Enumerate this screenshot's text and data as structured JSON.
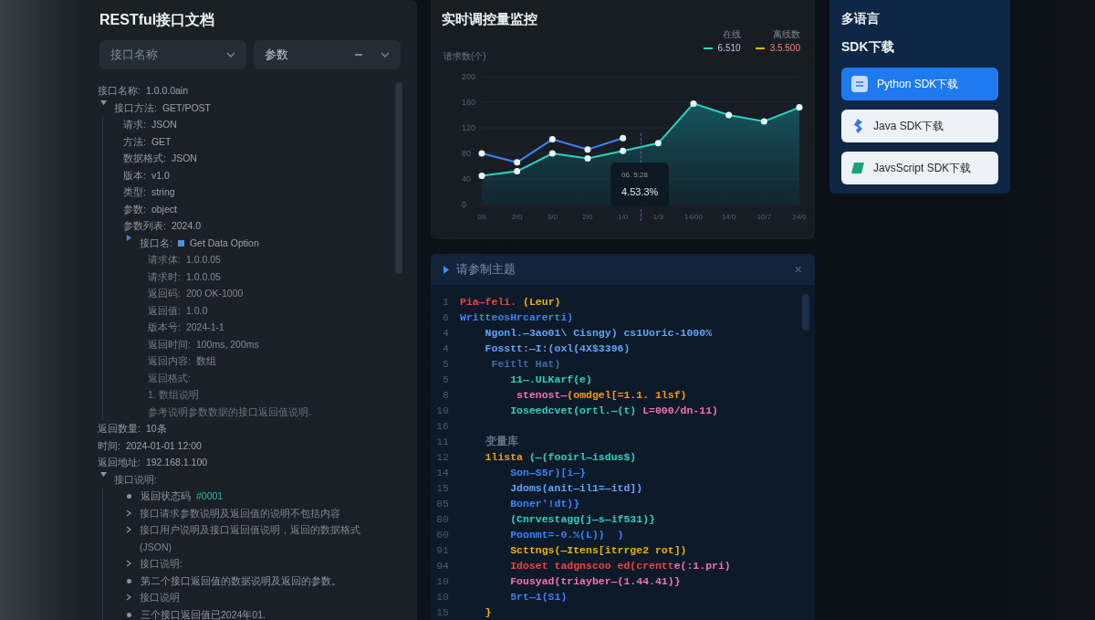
{
  "docs": {
    "title": "RESTful接口文档",
    "selects": [
      {
        "placeholder": "接口名称",
        "minus": false
      },
      {
        "value": "参数",
        "minus": true
      }
    ],
    "tree": [
      {
        "kind": "field",
        "label": "接口名称:",
        "value": "1.0.0.0ain"
      },
      {
        "kind": "field",
        "label": "接口方法:",
        "value": "GET/POST",
        "expanded": true,
        "children": [
          {
            "kind": "field",
            "label": "请求:",
            "value": "JSON"
          },
          {
            "kind": "field",
            "label": "方法:",
            "value": "GET"
          },
          {
            "kind": "field",
            "label": "数据格式:",
            "value": "JSON"
          },
          {
            "kind": "field",
            "label": "版本:",
            "value": "v1.0"
          },
          {
            "kind": "field",
            "label": "类型:",
            "value": "string"
          },
          {
            "kind": "field",
            "label": "参数:",
            "value": "object"
          },
          {
            "kind": "field",
            "label": "参数列表:",
            "value": "2024.0"
          },
          {
            "kind": "field",
            "label": "接口名:",
            "value": "Get Data Option",
            "icon": true,
            "expanded": false,
            "children": [
              {
                "kind": "field",
                "label": "请求体:",
                "value": "1.0.0.05"
              },
              {
                "kind": "field",
                "label": "请求时:",
                "value": "1.0.0.05"
              },
              {
                "kind": "field",
                "label": "返回码:",
                "value": "200 OK-1000"
              },
              {
                "kind": "field",
                "label": "返回值:",
                "value": "1.0.0"
              },
              {
                "kind": "field",
                "label": "版本号:",
                "value": "2024-1-1"
              },
              {
                "kind": "field",
                "label": "返回时间:",
                "value": "100ms, 200ms"
              },
              {
                "kind": "field",
                "label": "返回内容:",
                "value": "数组"
              },
              {
                "kind": "text",
                "label": "返回格式:"
              },
              {
                "kind": "text",
                "label": "1. 数组说明"
              },
              {
                "kind": "text",
                "label": "参考说明参数数据的接口返回值说明."
              }
            ]
          }
        ]
      },
      {
        "kind": "field",
        "label": "返回数量:",
        "value": "10条"
      },
      {
        "kind": "field",
        "label": "时间:",
        "value": "2024-01-01 12:00"
      },
      {
        "kind": "field",
        "label": "返回地址:",
        "value": "192.168.1.100"
      },
      {
        "kind": "text",
        "label": "接口说明:",
        "expanded": true,
        "children": [
          {
            "kind": "bullet",
            "label": "返回状态码",
            "value": "#0001"
          },
          {
            "kind": "pointer",
            "label": "接口请求参数说明及返回值的说明不包括内容"
          },
          {
            "kind": "pointer",
            "label": "接口用户说明及接口返回值说明，返回的数据格式(JSON)"
          },
          {
            "kind": "pointer",
            "label": "接口说明:"
          },
          {
            "kind": "bullet",
            "label": "第二个接口返回值的数据说明及返回的参数。"
          },
          {
            "kind": "pointer",
            "label": "接口说明"
          },
          {
            "kind": "bullet",
            "label": "三个接口返回值已2024年01."
          }
        ]
      }
    ]
  },
  "monitor": {
    "title": "实时调控量监控",
    "legend": [
      {
        "label": "在线",
        "value": "6.510",
        "color": "#2dd4bf"
      },
      {
        "label": "离线数",
        "value": "3.5.500",
        "color": "#eab308"
      }
    ],
    "tooltip": {
      "title": "06. 5:28",
      "value": "4.53.3%"
    },
    "chart_data": {
      "type": "area",
      "ylabel": "请求数(个)",
      "categories": [
        "09",
        "2/0",
        "3/0",
        "2/0",
        "1/0",
        "1/3",
        "14/00",
        "14/0",
        "10/7",
        "24/0"
      ],
      "series": [
        {
          "type": "area",
          "marker": "circle",
          "color": "#2dd4bf",
          "values": [
            45,
            52,
            80,
            72,
            84,
            96,
            158,
            140,
            130,
            152
          ]
        },
        {
          "type": "line",
          "marker": "circle",
          "color": "#3b82f6",
          "values": [
            80,
            66,
            102,
            86,
            104,
            null,
            null,
            null,
            null,
            null
          ]
        }
      ],
      "ylim": [
        0,
        200
      ],
      "yticks": [
        0,
        40,
        80,
        120,
        160,
        200
      ],
      "grid": true
    }
  },
  "code": {
    "title": "请参制主题",
    "close": "×",
    "lines": [
      {
        "number": "1",
        "tokens": [
          {
            "text": "Pia—feli.",
            "color": "#ef4444"
          },
          {
            "text": " (Leur)",
            "color": "#eab308"
          }
        ]
      },
      {
        "number": "6",
        "tokens": [
          {
            "text": "WritteosHrcarerti)",
            "color": "#3b82f6"
          }
        ]
      },
      {
        "number": "4",
        "tokens": [
          {
            "text": "    Ngonl.—3ao01\\ Cisngy) cs1Uoric-1000%",
            "color": "#60a5fa"
          }
        ]
      },
      {
        "number": "4",
        "tokens": [
          {
            "text": "    Fosstt:—I:(oxl(4X$3396)",
            "color": "#60a5fa"
          }
        ]
      },
      {
        "number": "5",
        "tokens": [
          {
            "text": "     Feitlt Hat)",
            "color": "#3b6ea5"
          }
        ]
      },
      {
        "number": "5",
        "tokens": [
          {
            "text": "        11—.ULKarf(e)",
            "color": "#2dd4bf"
          }
        ]
      },
      {
        "number": "8",
        "tokens": [
          {
            "text": "         stenost—",
            "color": "#f472b6"
          },
          {
            "text": "(omdgel[=1.1. 1lsf)",
            "color": "#f59e0b"
          }
        ]
      },
      {
        "number": "10",
        "tokens": [
          {
            "text": "        Ioseedcvet(ortl.—(t) ",
            "color": "#2dd4bf"
          },
          {
            "text": "L=000/dn-11)",
            "color": "#f472b6"
          }
        ]
      },
      {
        "number": "16"
      },
      {
        "number": "11",
        "tokens": [
          {
            "text": "    变量库",
            "color": "#64748b"
          }
        ]
      },
      {
        "number": "12",
        "tokens": [
          {
            "text": "    1lista",
            "color": "#f59e0b"
          },
          {
            "text": " (—(fooirl—isdus$)",
            "color": "#2dd4bf"
          }
        ]
      },
      {
        "number": "14",
        "tokens": [
          {
            "text": "        Son—S5r)[i—}",
            "color": "#3b82f6"
          }
        ]
      },
      {
        "number": "15",
        "tokens": [
          {
            "text": "        Jdoms(anit—il1=—itd])",
            "color": "#60a5fa"
          }
        ]
      },
      {
        "number": "85",
        "tokens": [
          {
            "text": "        Boner'!dt)}",
            "color": "#3b82f6"
          }
        ]
      },
      {
        "number": "80",
        "tokens": [
          {
            "text": "        (Cnrvestagg(j—s—if531)}",
            "color": "#2dd4bf"
          }
        ]
      },
      {
        "number": "60",
        "tokens": [
          {
            "text": "        Poonmt=-0.%(L))  )",
            "color": "#3b82f6"
          }
        ]
      },
      {
        "number": "91",
        "tokens": [
          {
            "text": "        Scttngs(—Itens[itrrge2 rot])",
            "color": "#eab308"
          }
        ]
      },
      {
        "number": "94",
        "tokens": [
          {
            "text": "        Idoset tadgnscoo ed(crentt",
            "color": "#ef4444"
          },
          {
            "text": "e(:1.pri)",
            "color": "#f472b6"
          }
        ]
      },
      {
        "number": "10",
        "tokens": [
          {
            "text": "        Fousyad(triayber—(1.44.41)}",
            "color": "#f472b6"
          }
        ]
      },
      {
        "number": "10",
        "tokens": [
          {
            "text": "        5rt—1(S1)",
            "color": "#3b82f6"
          }
        ]
      },
      {
        "number": "15",
        "tokens": [
          {
            "text": "    }",
            "color": "#eab308"
          }
        ]
      }
    ]
  },
  "sdk": {
    "heading": "多语言",
    "subheading": "SDK下载",
    "buttons": [
      {
        "label": "Python SDK下载",
        "selected": true,
        "kind": "python"
      },
      {
        "label": "Java SDK下载",
        "selected": false,
        "kind": "java"
      },
      {
        "label": "JavsScript SDK下载",
        "selected": false,
        "kind": "js"
      }
    ]
  }
}
